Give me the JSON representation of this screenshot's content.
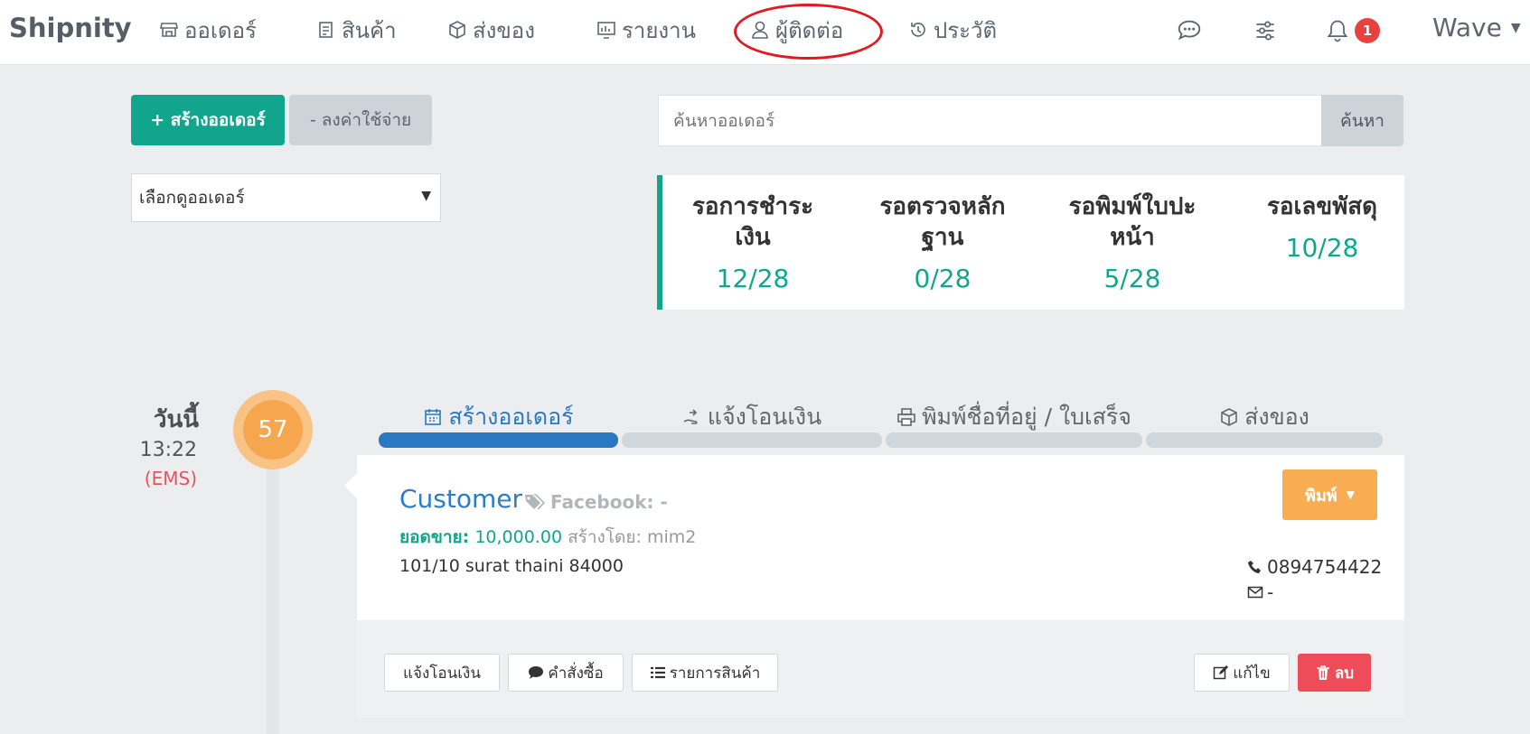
{
  "nav": {
    "brand": "Shipnity",
    "items": [
      {
        "label": "ออเดอร์",
        "icon": "store-icon"
      },
      {
        "label": "สินค้า",
        "icon": "tag-list-icon"
      },
      {
        "label": "ส่งของ",
        "icon": "box-icon"
      },
      {
        "label": "รายงาน",
        "icon": "chart-icon"
      },
      {
        "label": "ผู้ติดต่อ",
        "icon": "user-icon"
      },
      {
        "label": "ประวัติ",
        "icon": "history-icon"
      }
    ],
    "notification_count": "1",
    "user": "Wave",
    "highlight_color": "#e01a22"
  },
  "actions": {
    "create_order": "+ สร้างออเดอร์",
    "log_expense": "- ลงค่าใช้จ่าย",
    "order_filter": "เลือกดูออเดอร์",
    "search_placeholder": "ค้นหาออเดอร์",
    "search_button": "ค้นหา"
  },
  "stats": [
    {
      "label_line1": "รอการชำระ",
      "label_line2": "เงิน",
      "value": "12/28"
    },
    {
      "label_line1": "รอตรวจหลัก",
      "label_line2": "ฐาน",
      "value": "0/28"
    },
    {
      "label_line1": "รอพิมพ์ใบปะ",
      "label_line2": "หน้า",
      "value": "5/28"
    },
    {
      "label_line1": "รอเลขพัสดุ",
      "label_line2": "",
      "value": "10/28"
    }
  ],
  "timeline": {
    "day": "วันนี้",
    "time": "13:22",
    "carrier": "(EMS)",
    "count": "57"
  },
  "steps": [
    {
      "label": "สร้างออเดอร์",
      "active": true
    },
    {
      "label": "แจ้งโอนเงิน",
      "active": false
    },
    {
      "label": "พิมพ์ชื่อที่อยู่ / ใบเสร็จ",
      "active": false
    },
    {
      "label": "ส่งของ",
      "active": false
    }
  ],
  "order": {
    "customer": "Customer",
    "facebook": "Facebook: -",
    "sales_label": "ยอดขาย:",
    "sales_value": "10,000.00",
    "created_by": "สร้างโดย: mim2",
    "address": "101/10 surat thaini 84000",
    "phone": "0894754422",
    "email": "-",
    "print_button": "พิมพ์"
  },
  "footer": {
    "transfer": "แจ้งโอนเงิน",
    "order_note": "คำสั่งซื้อ",
    "items": "รายการสินค้า",
    "edit": "แก้ไข",
    "delete": "ลบ"
  },
  "colors": {
    "accent": "#12a58d",
    "primary": "#2b78c2",
    "warning": "#f8ad52",
    "danger": "#ee4c59"
  }
}
